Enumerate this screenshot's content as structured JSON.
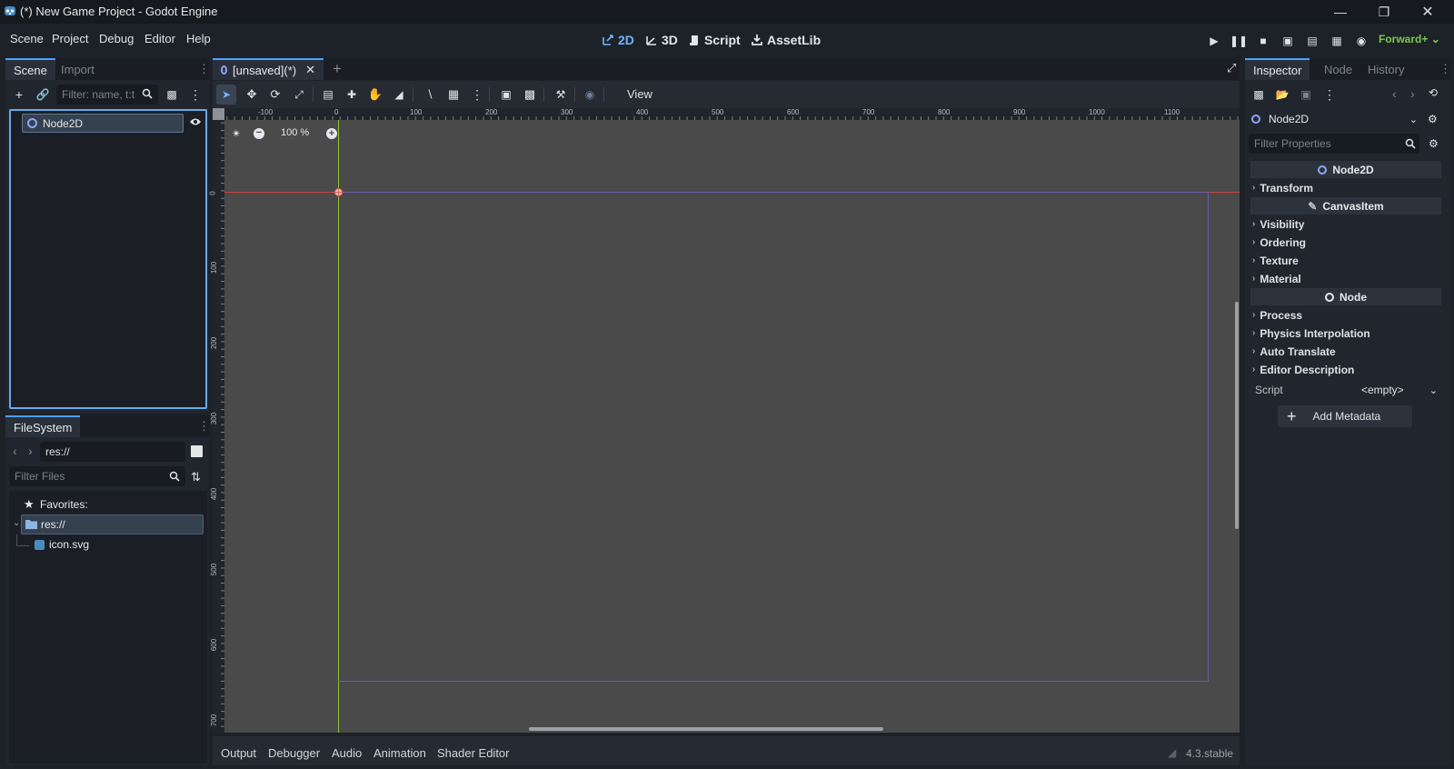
{
  "window": {
    "title": "(*) New Game Project - Godot Engine",
    "controls": [
      "minimize-icon",
      "restore-icon",
      "close-icon"
    ]
  },
  "menu": {
    "items": [
      "Scene",
      "Project",
      "Debug",
      "Editor",
      "Help"
    ]
  },
  "workspaces": {
    "items": [
      {
        "label": "2D",
        "icon": "2d-icon",
        "active": true
      },
      {
        "label": "3D",
        "icon": "3d-icon",
        "active": false
      },
      {
        "label": "Script",
        "icon": "script-icon",
        "active": false
      },
      {
        "label": "AssetLib",
        "icon": "assetlib-icon",
        "active": false
      }
    ]
  },
  "run_bar": {
    "renderer": "Forward+"
  },
  "scene_dock": {
    "tabs": [
      "Scene",
      "Import"
    ],
    "filter_placeholder": "Filter: name, t:t",
    "tree": [
      {
        "label": "Node2D",
        "icon": "node2d-icon",
        "selected": true,
        "visible": true
      }
    ]
  },
  "filesystem_dock": {
    "tab": "FileSystem",
    "path": "res://",
    "filter_placeholder": "Filter Files",
    "favorites_label": "Favorites:",
    "items": [
      {
        "label": "res://",
        "icon": "folder-icon",
        "selected": true
      },
      {
        "label": "icon.svg",
        "icon": "svg-file-icon",
        "selected": false
      }
    ]
  },
  "editor": {
    "scene_tab": "[unsaved](*)",
    "toolbar_view_label": "View",
    "zoom": "100 %",
    "ruler_top": [
      "-100",
      "0",
      "100",
      "200",
      "300",
      "400",
      "500",
      "600",
      "700",
      "800",
      "900",
      "1000",
      "1100"
    ],
    "ruler_left": [
      "0",
      "100",
      "200",
      "300",
      "400",
      "500",
      "600",
      "700"
    ]
  },
  "bottom_panel": {
    "tabs": [
      "Output",
      "Debugger",
      "Audio",
      "Animation",
      "Shader Editor"
    ],
    "version": "4.3.stable"
  },
  "inspector": {
    "tabs": [
      "Inspector",
      "Node",
      "History"
    ],
    "object_name": "Node2D",
    "filter_placeholder": "Filter Properties",
    "categories": [
      {
        "name": "Node2D",
        "icon": "node2d-icon",
        "sections": [
          "Transform"
        ]
      },
      {
        "name": "CanvasItem",
        "icon": "canvasitem-icon",
        "sections": [
          "Visibility",
          "Ordering",
          "Texture",
          "Material"
        ]
      },
      {
        "name": "Node",
        "icon": "node-icon",
        "sections": [
          "Process",
          "Physics Interpolation",
          "Auto Translate",
          "Editor Description"
        ]
      }
    ],
    "script_label": "Script",
    "script_value": "<empty>",
    "add_metadata_label": "Add Metadata"
  },
  "colors": {
    "accent": "#4d9eff",
    "renderer": "#7bc74d",
    "x_axis": "#c84444",
    "y_axis": "#8cbf3a",
    "viewport_bg": "#4a4a4a"
  }
}
